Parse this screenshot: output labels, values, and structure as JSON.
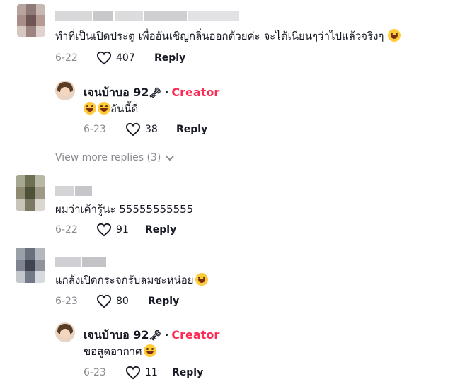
{
  "comments": [
    {
      "text": "ทำที่เป็นเปิดประตู เพื่ออันเชิญกลิ่นออกด้วยค่ะ จะได้เนียนๆว่าไปแล้วจริงๆ",
      "date": "6-22",
      "likes": "407",
      "reply_label": "Reply",
      "reply": {
        "username": "เจนบ้าบอ 92",
        "key_symbol": "🗝",
        "separator": "·",
        "badge": "Creator",
        "text": "อันนี้ดี",
        "date": "6-23",
        "likes": "38",
        "reply_label": "Reply"
      },
      "view_more": "View more replies (3)"
    },
    {
      "text": "ผมว่าเค้ารู้นะ 55555555555",
      "date": "6-22",
      "likes": "91",
      "reply_label": "Reply"
    },
    {
      "text": "แกล้งเปิดกระจกรับลมชะหน่อย",
      "date": "6-23",
      "likes": "80",
      "reply_label": "Reply",
      "reply": {
        "username": "เจนบ้าบอ 92",
        "key_symbol": "🗝",
        "separator": "·",
        "badge": "Creator",
        "text": "ขอสูดอากาศ",
        "date": "6-23",
        "likes": "11",
        "reply_label": "Reply"
      }
    }
  ],
  "colors": {
    "creator_badge": "#fe2c55",
    "meta_text": "#8a8b91",
    "primary_text": "#161823"
  },
  "icons": [
    "heart-outline-icon",
    "chevron-down-icon",
    "key-icon",
    "laughing-emoji-icon",
    "sweat-smile-emoji-icon"
  ]
}
